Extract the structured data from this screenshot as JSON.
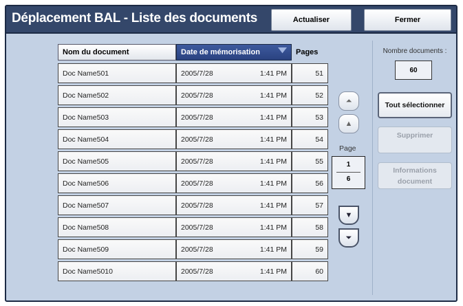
{
  "header": {
    "title": "Déplacement BAL - Liste des documents",
    "refresh": "Actualiser",
    "close": "Fermer"
  },
  "columns": {
    "name": "Nom du document",
    "date": "Date de mémorisation",
    "pages": "Pages"
  },
  "rows": [
    {
      "name": "Doc Name501",
      "date": "2005/7/28",
      "time": "1:41 PM",
      "pages": "51"
    },
    {
      "name": "Doc Name502",
      "date": "2005/7/28",
      "time": "1:41 PM",
      "pages": "52"
    },
    {
      "name": "Doc Name503",
      "date": "2005/7/28",
      "time": "1:41 PM",
      "pages": "53"
    },
    {
      "name": "Doc Name504",
      "date": "2005/7/28",
      "time": "1:41 PM",
      "pages": "54"
    },
    {
      "name": "Doc Name505",
      "date": "2005/7/28",
      "time": "1:41 PM",
      "pages": "55"
    },
    {
      "name": "Doc Name506",
      "date": "2005/7/28",
      "time": "1:41 PM",
      "pages": "56"
    },
    {
      "name": "Doc Name507",
      "date": "2005/7/28",
      "time": "1:41 PM",
      "pages": "57"
    },
    {
      "name": "Doc Name508",
      "date": "2005/7/28",
      "time": "1:41 PM",
      "pages": "58"
    },
    {
      "name": "Doc Name509",
      "date": "2005/7/28",
      "time": "1:41 PM",
      "pages": "59"
    },
    {
      "name": "Doc Name5010",
      "date": "2005/7/28",
      "time": "1:41 PM",
      "pages": "60"
    }
  ],
  "pager": {
    "label": "Page",
    "current": "1",
    "total": "6"
  },
  "side": {
    "count_label": "Nombre documents :",
    "count": "60",
    "select_all": "Tout sélectionner",
    "delete": "Supprimer",
    "info": "Informations document"
  }
}
